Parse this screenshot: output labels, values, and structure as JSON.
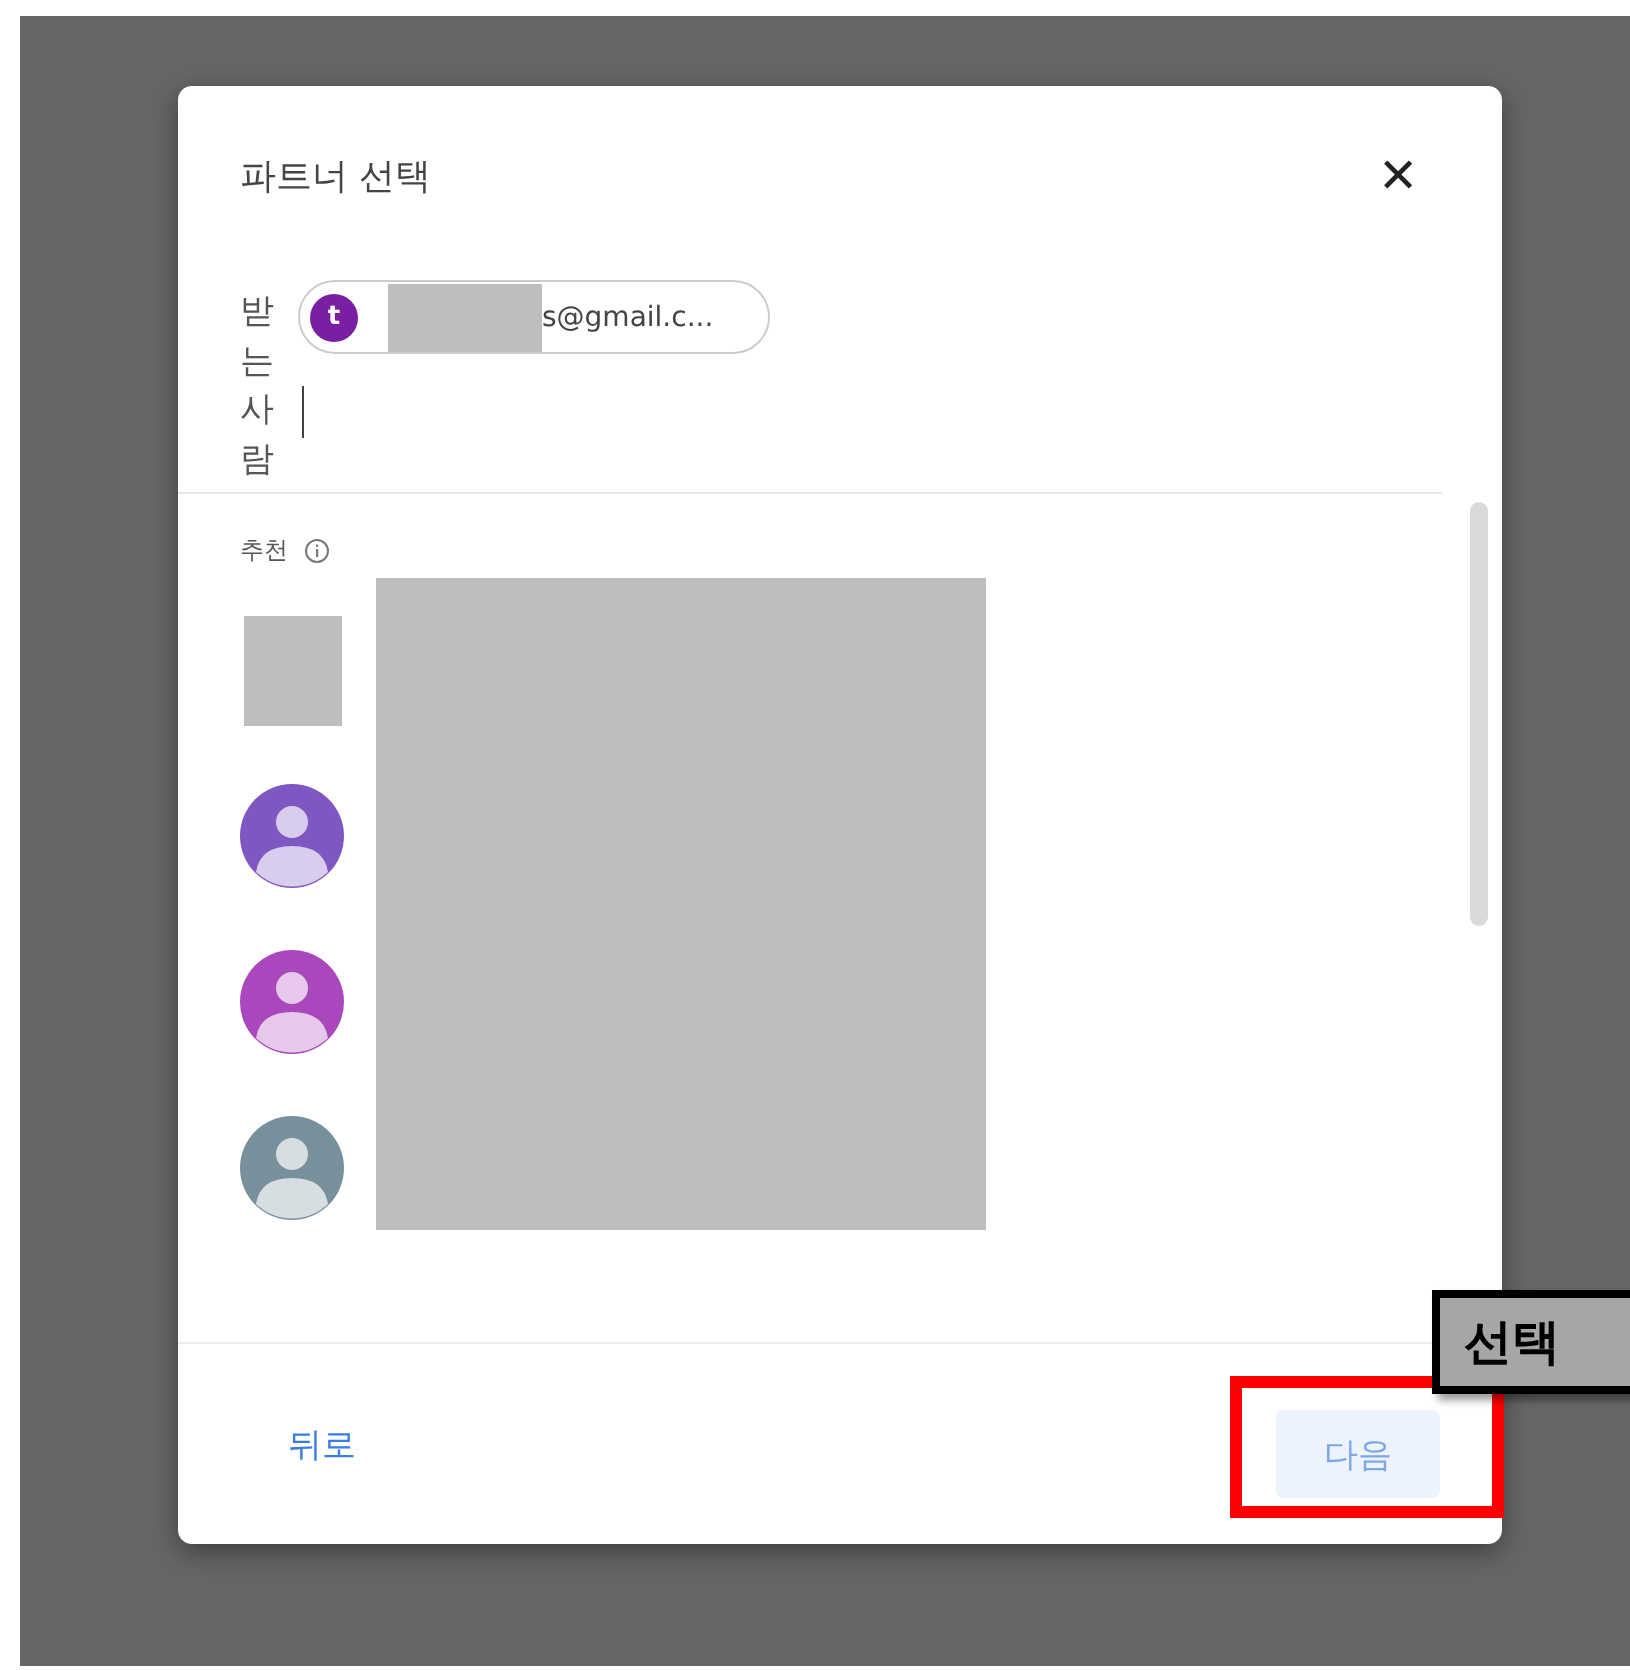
{
  "dialog": {
    "title": "파트너 선택",
    "close": "✕"
  },
  "recipients": {
    "label": "받는사람",
    "chips": [
      {
        "initial": "t",
        "color": "#7b1fa2",
        "email": "s@gmail.c...",
        "redacted": true
      }
    ]
  },
  "suggestions": {
    "label": "추천",
    "contacts": [
      {
        "kind": "redacted"
      },
      {
        "kind": "person",
        "color": "#7e57c2"
      },
      {
        "kind": "person",
        "color": "#ab47bc"
      },
      {
        "kind": "person",
        "color": "#78909c"
      }
    ]
  },
  "footer": {
    "back": "뒤로",
    "next": "다음"
  },
  "annotation": {
    "label": "선택"
  }
}
